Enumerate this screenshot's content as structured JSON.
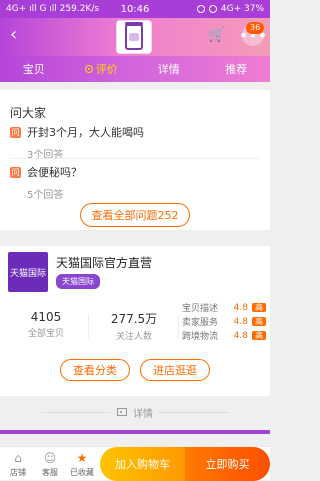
{
  "status_bar": {
    "left_text": "4G+ ıll G ıll 259.2K/s",
    "time": "10:46",
    "right_text": "4G+ 37%"
  },
  "header": {
    "badge_count": "36"
  },
  "tabs": [
    {
      "label": "宝贝",
      "active": false
    },
    {
      "label": "评价",
      "active": true
    },
    {
      "label": "详情",
      "active": false
    },
    {
      "label": "推荐",
      "active": false
    }
  ],
  "qa": {
    "title": "问大家",
    "questions": [
      {
        "q": "开封3个月，大人能喝吗",
        "answers": "3个回答"
      },
      {
        "q": "会便秘吗？",
        "answers": "5个回答"
      }
    ],
    "view_all": "查看全部问题252"
  },
  "store": {
    "logo_text": "天猫国际",
    "name": "天猫国际官方直营",
    "badge": "天猫国际",
    "stats": [
      {
        "num": "4105",
        "label": "全部宝贝"
      },
      {
        "num": "277.5万",
        "label": "关注人数"
      }
    ],
    "scores": [
      {
        "label": "宝贝描述",
        "value": "4.8",
        "tag": "高"
      },
      {
        "label": "卖家服务",
        "value": "4.8",
        "tag": "高"
      },
      {
        "label": "跨境物流",
        "value": "4.8",
        "tag": "高"
      }
    ],
    "buttons": {
      "category": "查看分类",
      "visit": "进店逛逛"
    }
  },
  "details_label": "详情",
  "bottom_bar": {
    "store": "店铺",
    "service": "客服",
    "favorite": "已收藏",
    "add_to_cart": "加入购物车",
    "buy_now": "立即购买"
  }
}
